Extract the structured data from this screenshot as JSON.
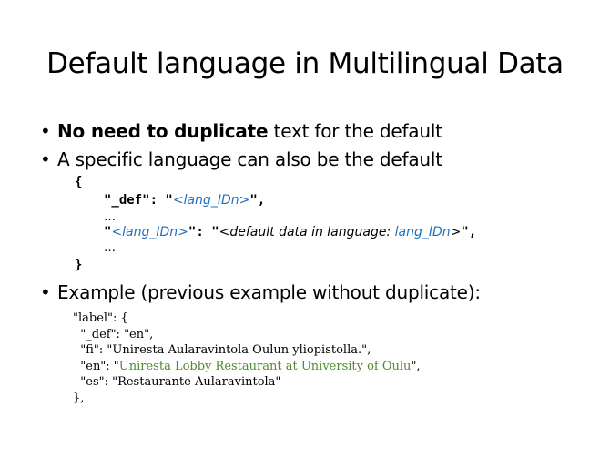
{
  "title": "Default language in Multilingual Data",
  "bullets": {
    "b1_bold": "No need to duplicate",
    "b1_rest": " text for the default",
    "b2": "A specific language can also be the default",
    "b3": "Example (previous example without duplicate):",
    "symbol": "•"
  },
  "code1": {
    "open_brace": "{",
    "def_key": "\"_def\": \"",
    "def_var": "<lang_IDn>",
    "def_end": "\",",
    "ellipsis_1": "…",
    "key_open": "\"",
    "key_var": "<lang_IDn>",
    "key_close": "\": \"",
    "value_text": "<default data in language: ",
    "value_var": "lang_IDn",
    "value_end": ">",
    "line_end": "\",",
    "ellipsis_2": "…",
    "close_brace": "}"
  },
  "code2": {
    "line1": "\"label\": {",
    "line2": "  \"_def\": \"en\",",
    "line3": "  \"fi\": \"Uniresta Aularavintola Oulun yliopistolla.\",",
    "line4_prefix": "  \"en\": \"",
    "line4_green": "Uniresta Lobby Restaurant at University of Oulu",
    "line4_suffix": "\",",
    "line5": "  \"es\": \"Restaurante Aularavintola\"",
    "line6": "},"
  },
  "colors": {
    "blue": "#1f6fbf",
    "green": "#4f8a2e"
  }
}
